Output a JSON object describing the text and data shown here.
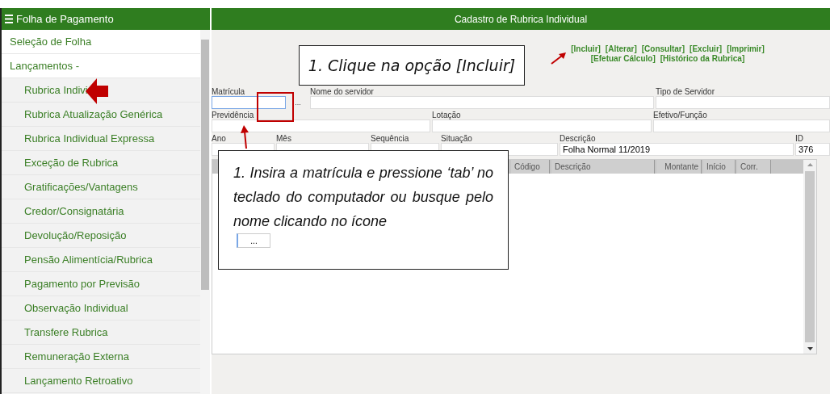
{
  "sidebar": {
    "title": "Folha de Pagamento",
    "items": [
      {
        "label": "Seleção de Folha"
      },
      {
        "label": "Lançamentos -",
        "children": [
          {
            "label": "Rubrica Indivi"
          },
          {
            "label": "Rubrica Atualização Genérica"
          },
          {
            "label": "Rubrica Individual Expressa"
          },
          {
            "label": "Exceção de Rubrica"
          },
          {
            "label": "Gratificações/Vantagens"
          },
          {
            "label": "Credor/Consignatária"
          },
          {
            "label": "Devolução/Reposição"
          },
          {
            "label": "Pensão Alimentícia/Rubrica"
          },
          {
            "label": "Pagamento por Previsão"
          },
          {
            "label": "Observação Individual"
          },
          {
            "label": "Transfere Rubrica"
          },
          {
            "label": "Remuneração Externa"
          },
          {
            "label": "Lançamento Retroativo"
          }
        ]
      }
    ]
  },
  "panel": {
    "title": "Cadastro de Rubrica Individual",
    "actions": [
      [
        "[Incluir]",
        "[Alterar]",
        "[Consultar]",
        "[Excluir]",
        "[Imprimir]"
      ],
      [
        "[Efetuar Cálculo]",
        "[Histórico da Rubrica]"
      ]
    ],
    "fields": [
      [
        {
          "label": "Matrícula",
          "kind": "lookup",
          "button": "..."
        },
        {
          "label": "Nome do servidor",
          "kind": "text"
        },
        {
          "label": "Tipo de Servidor",
          "kind": "text"
        }
      ],
      [
        {
          "label": "Previdência",
          "kind": "text"
        },
        {
          "label": "Lotação",
          "kind": "text"
        },
        {
          "label": "Efetivo/Função",
          "kind": "text"
        }
      ],
      [
        {
          "label": "Ano",
          "kind": "text"
        },
        {
          "label": "Mês",
          "kind": "text"
        },
        {
          "label": "Sequência",
          "kind": "text"
        },
        {
          "label": "Situação",
          "kind": "text"
        },
        {
          "label": "Descrição",
          "kind": "text",
          "value": "Folha Normal 11/2019"
        },
        {
          "label": "ID",
          "kind": "text",
          "value": "376"
        }
      ]
    ],
    "table": {
      "columns": [
        "Código",
        "Descrição",
        "Montante",
        "Início",
        "Corr."
      ]
    }
  },
  "callouts": [
    {
      "text": "1. Clique na opção [Incluir]"
    },
    {
      "text": "1. Insira a matrícula e pressione ‘tab’ no teclado do computador ou busque pelo nome clicando no ícone",
      "button": "..."
    }
  ]
}
